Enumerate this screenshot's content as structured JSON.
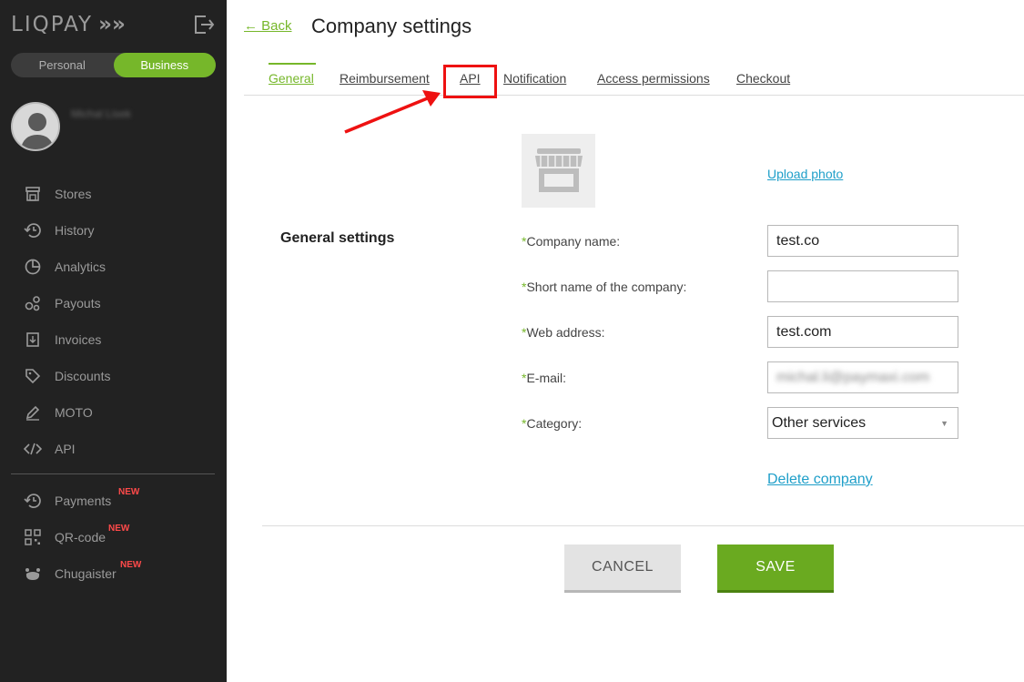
{
  "sidebar": {
    "logo": "LIQPAY",
    "logo_mark": "»",
    "account_toggle": [
      "Personal",
      "Business"
    ],
    "active_account": "Business",
    "user_name": "Michal Lisek",
    "menu": [
      {
        "label": "Stores",
        "icon": "store-icon"
      },
      {
        "label": "History",
        "icon": "history-icon"
      },
      {
        "label": "Analytics",
        "icon": "analytics-icon"
      },
      {
        "label": "Payouts",
        "icon": "payouts-icon"
      },
      {
        "label": "Invoices",
        "icon": "invoice-icon"
      },
      {
        "label": "Discounts",
        "icon": "tag-icon"
      },
      {
        "label": "MOTO",
        "icon": "pen-icon"
      },
      {
        "label": "API",
        "icon": "code-icon"
      }
    ],
    "menu_new": [
      {
        "label": "Payments",
        "icon": "payments-icon",
        "badge": "NEW"
      },
      {
        "label": "QR-code",
        "icon": "qr-code-icon",
        "badge": "NEW"
      },
      {
        "label": "Chugaister",
        "icon": "chugaister-icon",
        "badge": "NEW"
      }
    ]
  },
  "header": {
    "back_label": "← Back",
    "title": "Company settings"
  },
  "tabs": [
    "General",
    "Reimbursement",
    "API",
    "Notification",
    "Access permissions",
    "Checkout"
  ],
  "active_tab": "General",
  "annotation": {
    "highlighted_tab": "API",
    "color": "#ee1111"
  },
  "form": {
    "section_title": "General settings",
    "upload_label": "Upload photo",
    "required_mark": "*",
    "fields": [
      {
        "label": "Company name:",
        "value": "test.co"
      },
      {
        "label": "Short name of the company:",
        "value": ""
      },
      {
        "label": "Web address:",
        "value": "test.com"
      },
      {
        "label": "E-mail:",
        "value": "michal.li@paymaxi.com"
      },
      {
        "label": "Category:",
        "value": "Other services"
      }
    ],
    "delete_label": "Delete company"
  },
  "actions": {
    "cancel": "CANCEL",
    "save": "SAVE"
  },
  "colors": {
    "accent": "#76b72a",
    "link": "#1f9fc9",
    "sidebar_bg": "#222222"
  }
}
